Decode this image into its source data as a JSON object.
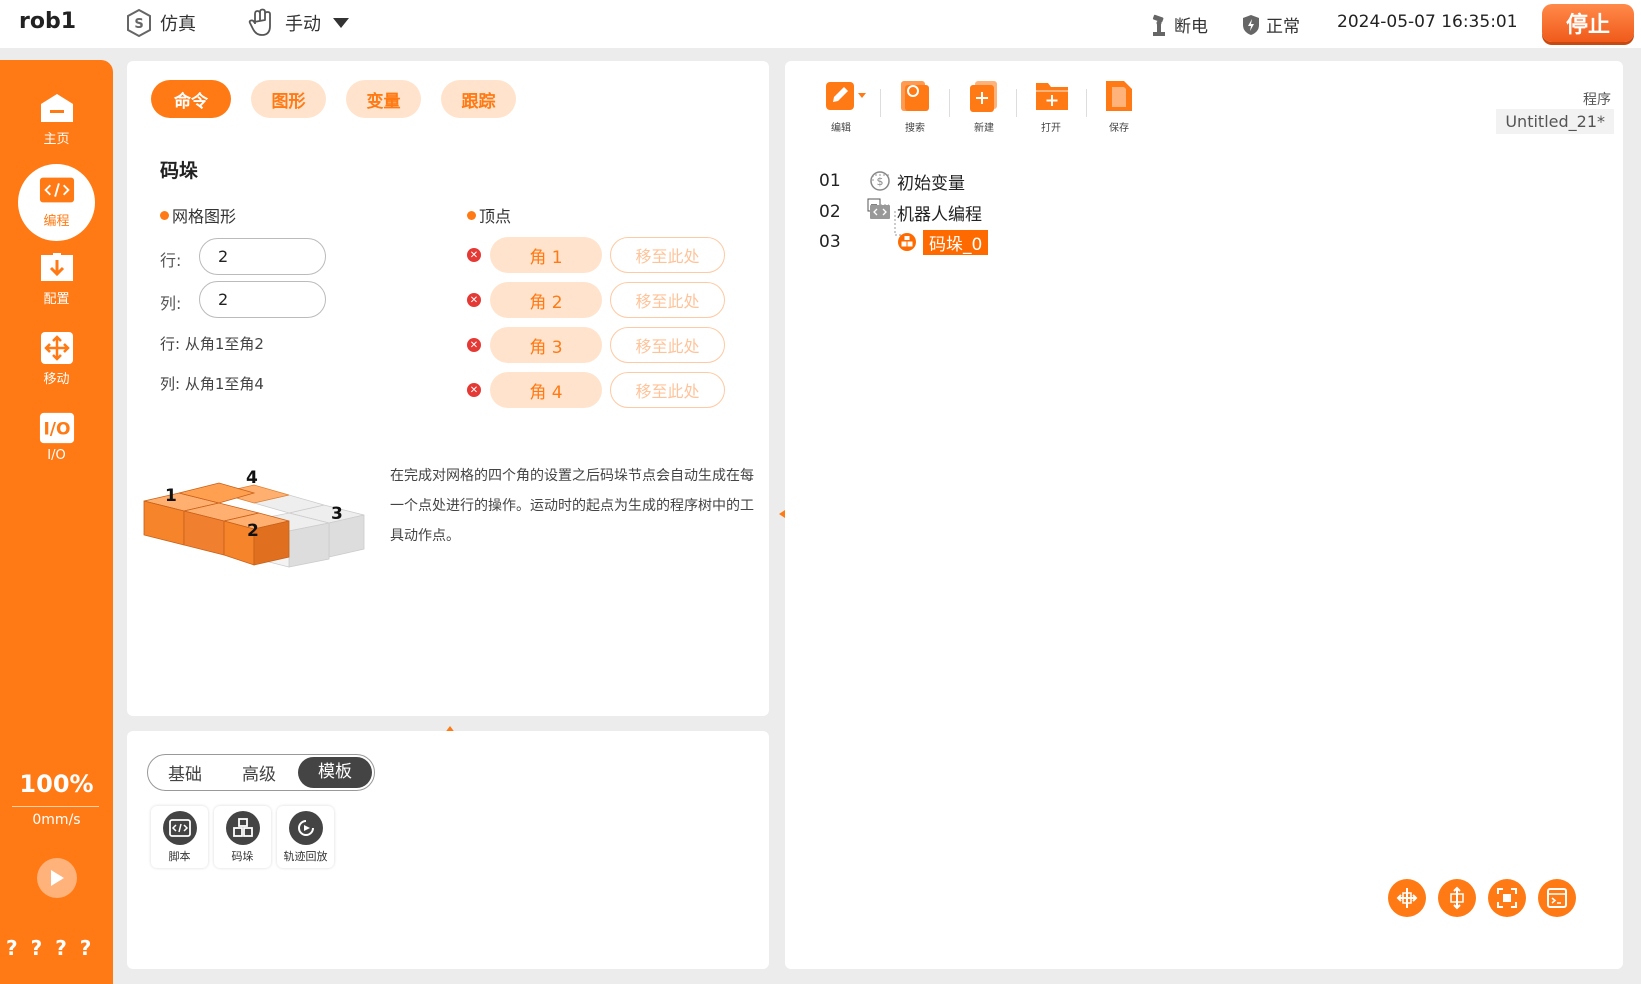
{
  "topbar": {
    "robot_name": "rob1",
    "sim_label": "仿真",
    "manual_label": "手动",
    "power_label": "断电",
    "safety_label": "正常",
    "datetime": "2024-05-07 16:35:01",
    "stop_label": "停止"
  },
  "sidebar": {
    "items": [
      {
        "label": "主页",
        "icon": "home-icon"
      },
      {
        "label": "编程",
        "icon": "code-icon"
      },
      {
        "label": "配置",
        "icon": "download-icon"
      },
      {
        "label": "移动",
        "icon": "move-icon"
      },
      {
        "label": "I/O",
        "icon": "io-icon"
      }
    ],
    "speed_percent": "100%",
    "speed_value": "0mm/s",
    "help_marks": "????"
  },
  "command_panel": {
    "tabs": [
      "命令",
      "图形",
      "变量",
      "跟踪"
    ],
    "active_tab": "命令",
    "title": "码垛",
    "grid_heading": "网格图形",
    "vertex_heading": "顶点",
    "row_label": "行:",
    "col_label": "列:",
    "row_value": "2",
    "col_value": "2",
    "row_note": "行: 从角1至角2",
    "col_note": "列: 从角1至角4",
    "corners": [
      "角 1",
      "角 2",
      "角 3",
      "角 4"
    ],
    "move_here_label": "移至此处",
    "figure_labels": [
      "1",
      "4",
      "2",
      "3"
    ],
    "description": "在完成对网格的四个角的设置之后码垛节点会自动生成在每一个点处进行的操作。运动时的起点为生成的程序树中的工具动作点。"
  },
  "library_panel": {
    "segments": [
      "基础",
      "高级",
      "模板"
    ],
    "active_segment": "模板",
    "items": [
      {
        "label": "脚本",
        "icon": "script-icon"
      },
      {
        "label": "码垛",
        "icon": "pallet-icon"
      },
      {
        "label": "轨迹回放",
        "icon": "replay-icon"
      }
    ]
  },
  "program_panel": {
    "toolbar": [
      {
        "label": "编辑",
        "icon": "edit-icon"
      },
      {
        "label": "搜索",
        "icon": "search-icon"
      },
      {
        "label": "新建",
        "icon": "new-file-icon"
      },
      {
        "label": "打开",
        "icon": "open-folder-icon"
      },
      {
        "label": "保存",
        "icon": "save-icon"
      }
    ],
    "program_label": "程序",
    "program_name": "Untitled_21*",
    "tree": [
      {
        "num": "01",
        "label": "初始变量"
      },
      {
        "num": "02",
        "label": "机器人编程"
      },
      {
        "num": "03",
        "label": "码垛_0"
      }
    ],
    "bottom_tools": [
      "fit-horizontal-icon",
      "fit-vertical-icon",
      "fit-screen-icon",
      "console-icon"
    ]
  },
  "colors": {
    "accent": "#ff7a14",
    "accent_light": "#ffe3cc",
    "stop": "#f05a1a"
  }
}
